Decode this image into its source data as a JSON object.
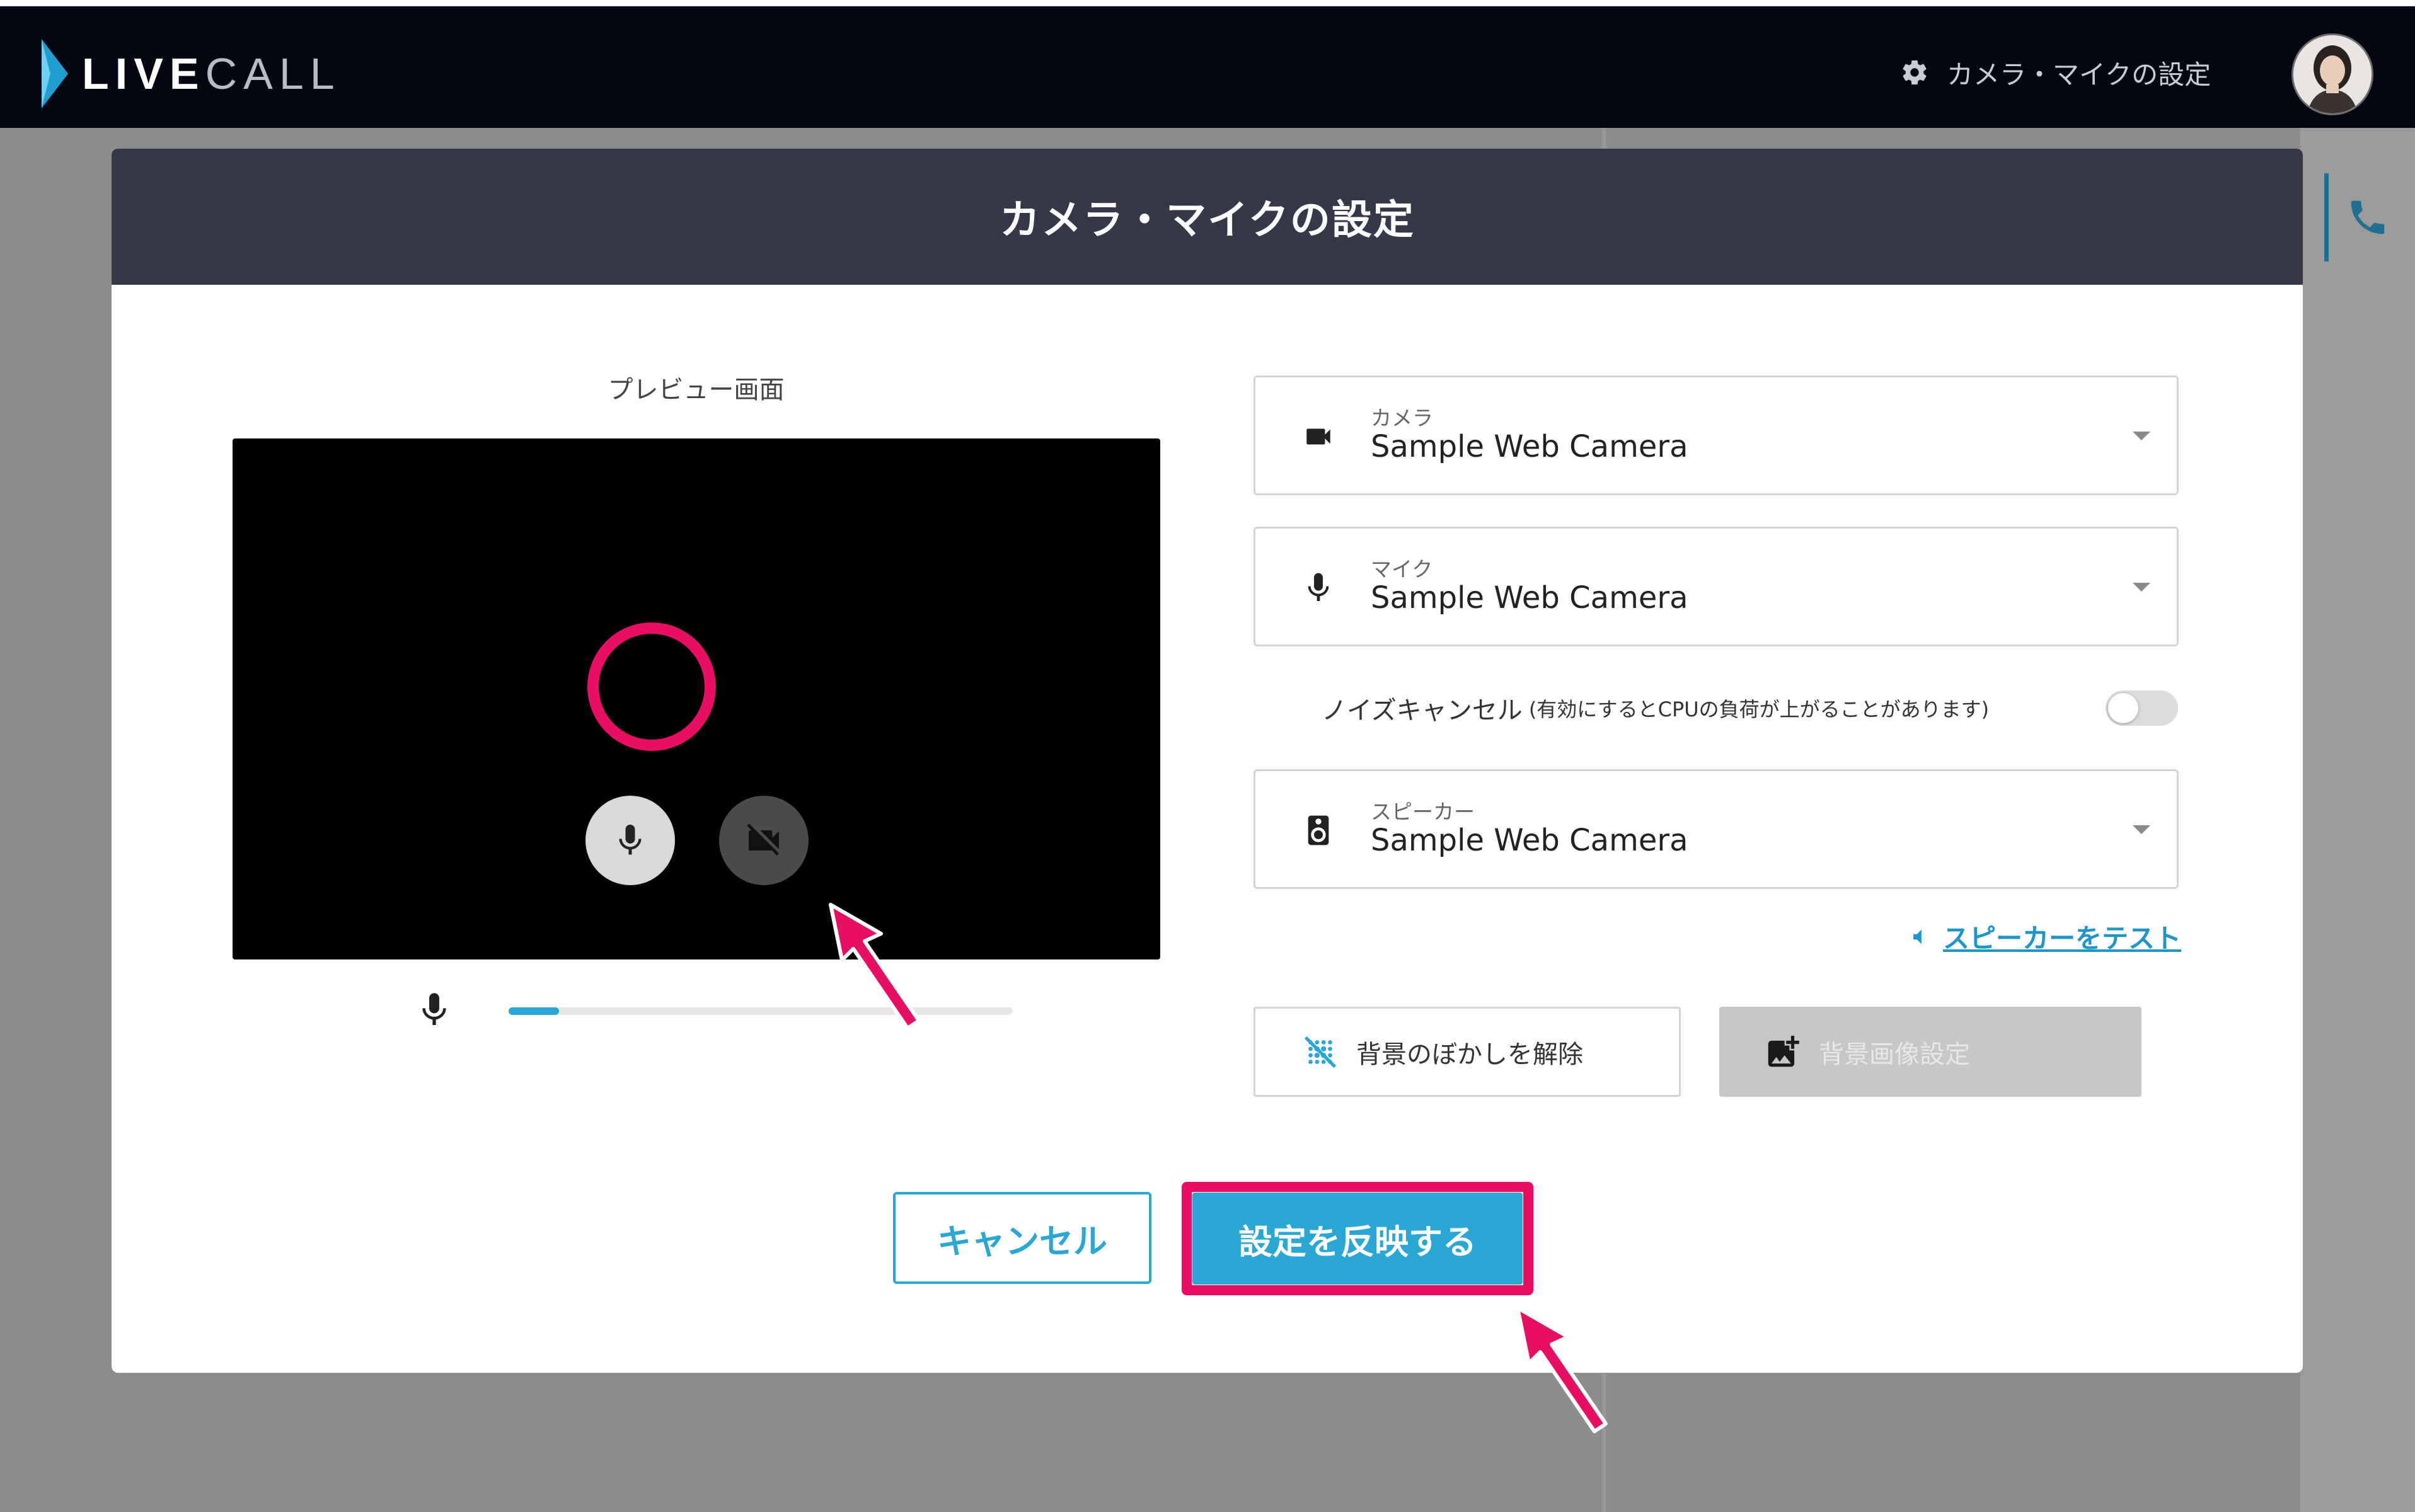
{
  "topbar": {
    "logo_bold": "LIVE",
    "logo_light": "CALL",
    "settings_link": "カメラ・マイクの設定",
    "settings_icon": "gear-icon",
    "avatar_icon": "user-avatar"
  },
  "modal": {
    "title": "カメラ・マイクの設定",
    "preview": {
      "title": "プレビュー画面",
      "mic_level_fraction": 0.1
    },
    "camera": {
      "label": "カメラ",
      "value": "Sample Web Camera",
      "icon": "videocam-icon"
    },
    "mic": {
      "label": "マイク",
      "value": "Sample Web Camera",
      "icon": "mic-icon"
    },
    "noise_cancel": {
      "label": "ノイズキャンセル",
      "note": "(有効にするとCPUの負荷が上がることがあります)",
      "enabled": false
    },
    "speaker": {
      "label": "スピーカー",
      "value": "Sample Web Camera",
      "icon": "speaker-icon"
    },
    "test_speaker": "スピーカーをテスト",
    "blur_button": "背景のぼかしを解除",
    "bg_image_button": "背景画像設定",
    "cancel_button": "キャンセル",
    "apply_button": "設定を反映する"
  },
  "colors": {
    "accent": "#2aa7d5",
    "highlight": "#e80e64",
    "header_bg": "#343849",
    "topbar_bg": "#040712"
  }
}
